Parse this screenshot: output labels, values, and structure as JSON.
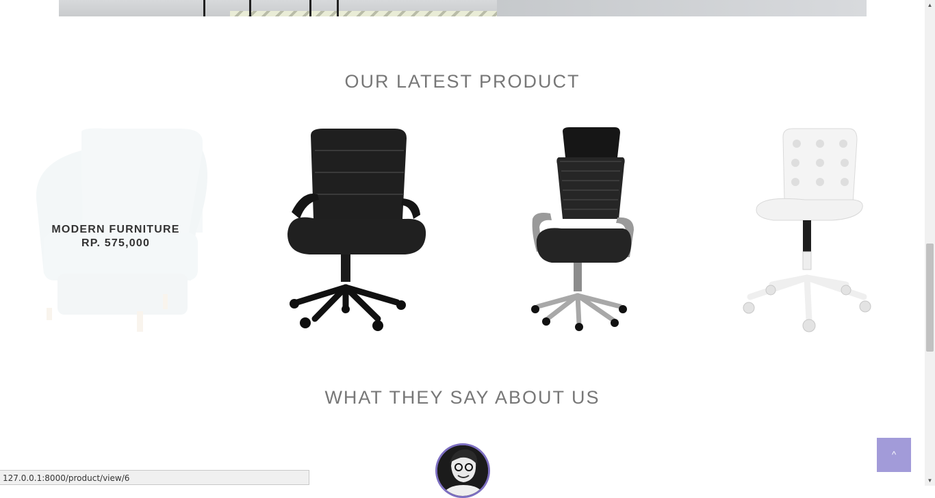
{
  "sections": {
    "latest_title": "OUR LATEST PRODUCT",
    "testimonials_title": "WHAT THEY SAY ABOUT US"
  },
  "products": [
    {
      "name": "MODERN FURNITURE",
      "price": "RP. 575,000",
      "icon": "armchair-image",
      "hovered": true
    },
    {
      "icon": "office-chair-image"
    },
    {
      "icon": "mesh-office-chair-image"
    },
    {
      "icon": "white-swivel-chair-image"
    }
  ],
  "scroll_top": {
    "icon": "chevron-up-icon",
    "glyph": "^"
  },
  "status_bar": {
    "url": "127.0.0.1:8000/product/view/6"
  },
  "colors": {
    "title_gray": "#777777",
    "scroll_top_bg": "#a29bd9",
    "avatar_border": "#7d6fc1"
  }
}
